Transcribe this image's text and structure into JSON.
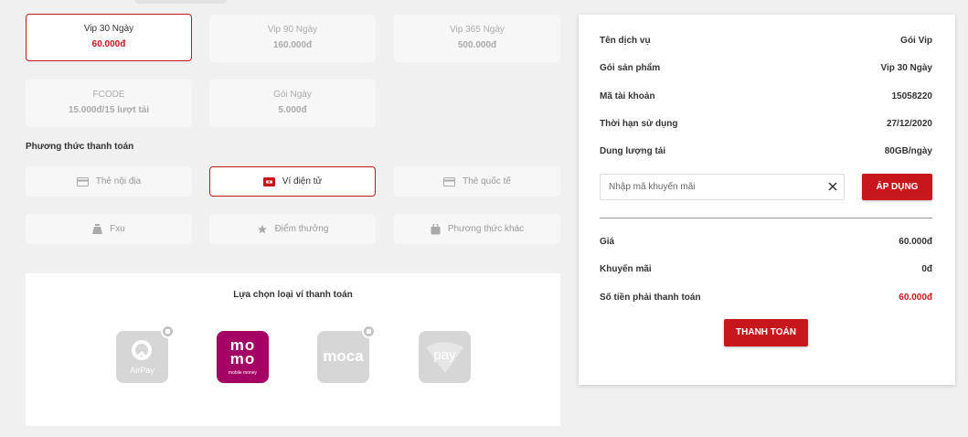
{
  "packages": [
    {
      "name": "Vip 30 Ngày",
      "price": "60.000đ",
      "selected": true
    },
    {
      "name": "Vip 90 Ngày",
      "price": "160.000đ",
      "selected": false
    },
    {
      "name": "Vip 365 Ngày",
      "price": "500.000đ",
      "selected": false
    },
    {
      "name": "FCODE",
      "price": "15.000đ/15 lượt tải",
      "selected": false
    },
    {
      "name": "Gói Ngày",
      "price": "5.000đ",
      "selected": false
    }
  ],
  "payment": {
    "title": "Phương thức thanh toán",
    "methods": [
      {
        "label": "Thẻ nội địa",
        "icon": "card-icon",
        "selected": false
      },
      {
        "label": "Ví điện tử",
        "icon": "wallet-icon",
        "selected": true
      },
      {
        "label": "Thẻ quốc tế",
        "icon": "card-icon",
        "selected": false
      },
      {
        "label": "Fxu",
        "icon": "money-bag-icon",
        "selected": false
      },
      {
        "label": "Điểm thưởng",
        "icon": "star-icon",
        "selected": false
      },
      {
        "label": "Phương thức khác",
        "icon": "bag-icon",
        "selected": false
      }
    ]
  },
  "wallets": {
    "title": "Lựa chọn loại ví thanh toán",
    "items": [
      {
        "name": "AirPay",
        "locked": true,
        "active": false
      },
      {
        "name": "momo",
        "subtitle": "mobile money",
        "locked": false,
        "active": true
      },
      {
        "name": "moca",
        "locked": true,
        "active": false
      },
      {
        "name": "pay",
        "locked": false,
        "active": false
      }
    ]
  },
  "summary": {
    "service_label": "Tên dịch vụ",
    "service_value": "Gói Vip",
    "product_label": "Gói sản phẩm",
    "product_value": "Vip 30 Ngày",
    "account_label": "Mã tài khoản",
    "account_value": "15058220",
    "expiry_label": "Thời hạn sử dụng",
    "expiry_value": "27/12/2020",
    "quota_label": "Dung lượng tải",
    "quota_value": "80GB/ngày",
    "promo_placeholder": "Nhập mã khuyến mãi",
    "promo_value": "",
    "apply_label": "ÁP DỤNG",
    "price_label": "Giá",
    "price_value": "60.000đ",
    "discount_label": "Khuyến mãi",
    "discount_value": "0đ",
    "total_label": "Số tiền phải thanh toán",
    "total_value": "60.000đ",
    "pay_label": "THANH TOÁN"
  },
  "colors": {
    "accent": "#c8161d",
    "momo": "#a50064"
  }
}
